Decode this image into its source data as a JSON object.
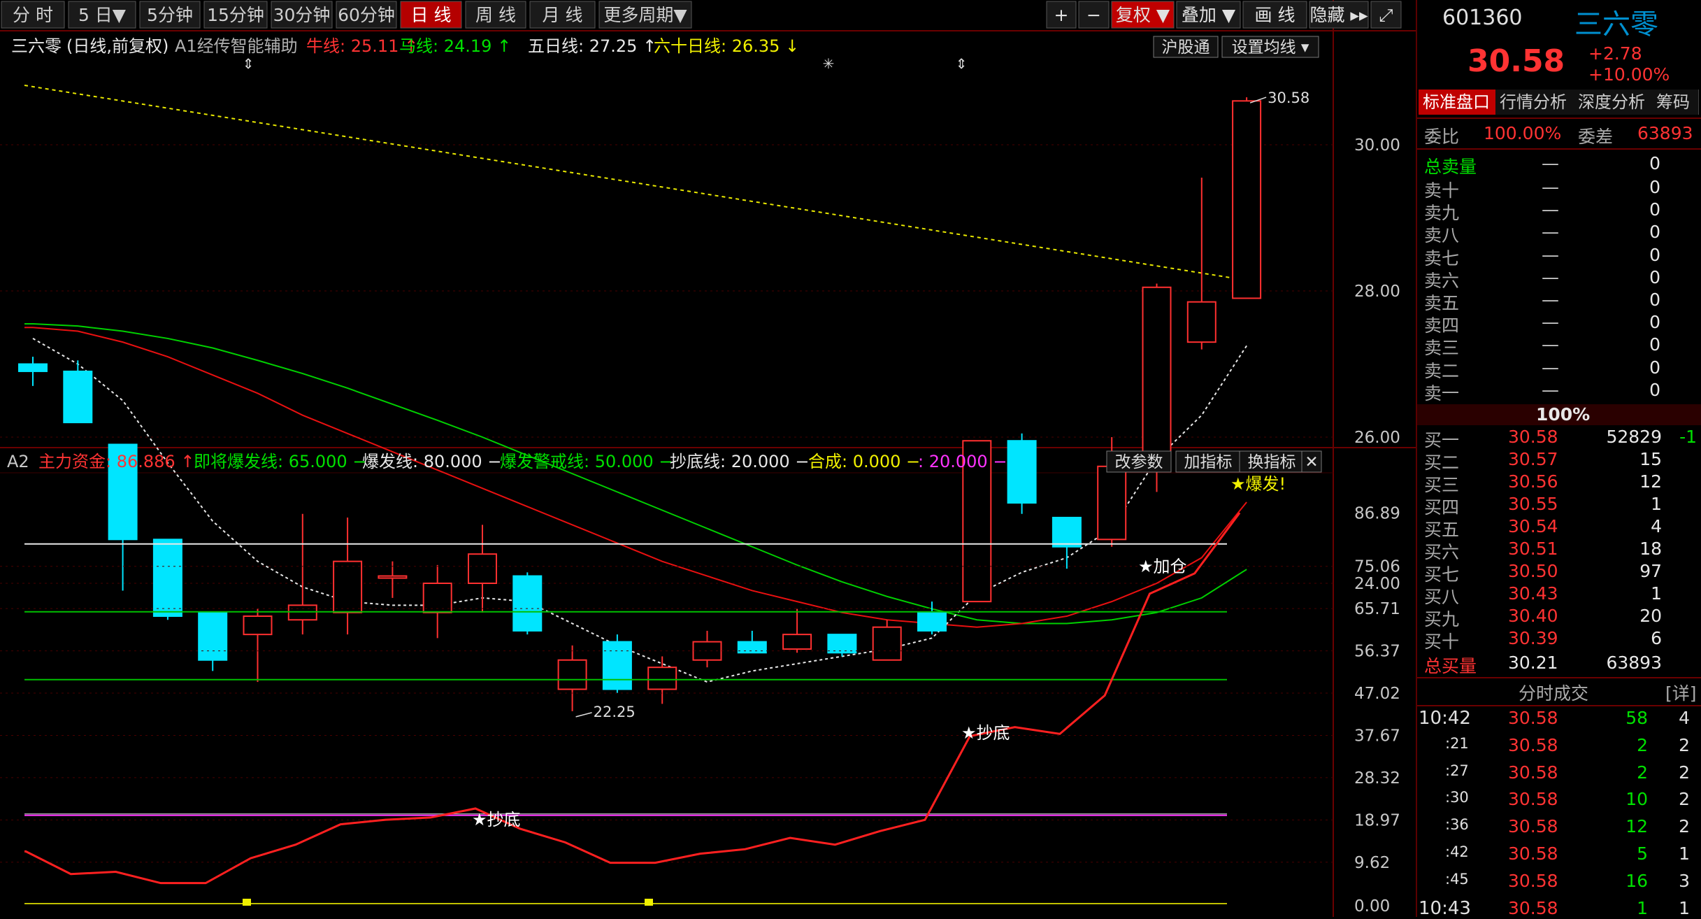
{
  "toolbar": {
    "period_buttons": [
      "分 时",
      "5 日▼",
      "5分钟",
      "15分钟",
      "30分钟",
      "60分钟",
      "日 线",
      "周 线",
      "月 线",
      "更多周期▼"
    ],
    "active_period": "日 线",
    "right_buttons": [
      "+",
      "−",
      "复权 ▼",
      "叠加 ▼",
      "画 线",
      "隐藏 ▸▸",
      "⤢"
    ]
  },
  "main_chart": {
    "title": "三六零",
    "mode": "(日线,前复权)",
    "indicator_name": "A1经传智能辅助",
    "ma_labels": [
      {
        "name": "牛线:",
        "value": "25.11",
        "arrow": "↑",
        "color": "#ff3333"
      },
      {
        "name": "马线:",
        "value": "24.19",
        "arrow": "↑",
        "color": "#00e000"
      },
      {
        "name": "五日线:",
        "value": "27.25",
        "arrow": "↑",
        "color": "#e8e8e8"
      },
      {
        "name": "六十日线:",
        "value": "26.35",
        "arrow": "↓",
        "color": "#f0f000"
      }
    ],
    "buttons": [
      "沪股通",
      "设置均线 ▾"
    ],
    "price_axis": [
      "30.00",
      "28.00",
      "26.00",
      "24.00"
    ],
    "high_label": "30.58",
    "low_label": "22.25",
    "markers": [
      "⇕",
      "✳",
      "⇕"
    ]
  },
  "lower_panel": {
    "tag": "A2",
    "labels": [
      {
        "text": "主力资金: 86.886 ↑",
        "color": "#ff3333"
      },
      {
        "text": "即将爆发线: 65.000 −",
        "color": "#00e000"
      },
      {
        "text": "爆发线: 80.000 −",
        "color": "#e8e8e8"
      },
      {
        "text": "爆发警戒线: 50.000 −",
        "color": "#00e000"
      },
      {
        "text": "抄底线: 20.000 −",
        "color": "#e8e8e8"
      },
      {
        "text": "合成: 0.000 −",
        "color": "#f0f000"
      },
      {
        "text": ": 20.000 −",
        "color": "#ff33ff"
      }
    ],
    "buttons": [
      "改参数",
      "加指标",
      "换指标",
      "✕"
    ],
    "axis": [
      "86.89",
      "75.06",
      "65.71",
      "56.37",
      "47.02",
      "37.67",
      "28.32",
      "18.97",
      "9.62",
      "0.00"
    ],
    "annotations": [
      "★爆发!",
      "★加仓",
      "★抄底",
      "★抄底"
    ]
  },
  "chart_data": {
    "type": "candlestick",
    "candles": [
      {
        "o": 27.0,
        "h": 27.1,
        "l": 26.7,
        "c": 26.9
      },
      {
        "o": 26.9,
        "h": 27.05,
        "l": 26.2,
        "c": 26.2
      },
      {
        "o": 25.9,
        "h": 25.9,
        "l": 23.9,
        "c": 24.6
      },
      {
        "o": 24.6,
        "h": 24.6,
        "l": 23.5,
        "c": 23.55
      },
      {
        "o": 23.6,
        "h": 23.6,
        "l": 22.8,
        "c": 22.95
      },
      {
        "o": 23.3,
        "h": 23.65,
        "l": 22.65,
        "c": 23.55
      },
      {
        "o": 23.5,
        "h": 24.95,
        "l": 23.3,
        "c": 23.7
      },
      {
        "o": 23.6,
        "h": 24.9,
        "l": 23.3,
        "c": 24.3
      },
      {
        "o": 24.1,
        "h": 24.3,
        "l": 23.8,
        "c": 24.1
      },
      {
        "o": 23.6,
        "h": 24.25,
        "l": 23.25,
        "c": 24.0
      },
      {
        "o": 24.0,
        "h": 24.8,
        "l": 23.6,
        "c": 24.4
      },
      {
        "o": 24.1,
        "h": 24.15,
        "l": 23.3,
        "c": 23.35
      },
      {
        "o": 22.55,
        "h": 23.15,
        "l": 22.25,
        "c": 22.95
      },
      {
        "o": 23.2,
        "h": 23.3,
        "l": 22.5,
        "c": 22.55
      },
      {
        "o": 22.55,
        "h": 23.0,
        "l": 22.35,
        "c": 22.85
      },
      {
        "o": 22.95,
        "h": 23.35,
        "l": 22.85,
        "c": 23.2
      },
      {
        "o": 23.2,
        "h": 23.35,
        "l": 23.05,
        "c": 23.05
      },
      {
        "o": 23.1,
        "h": 23.65,
        "l": 23.05,
        "c": 23.3
      },
      {
        "o": 23.3,
        "h": 23.3,
        "l": 23.0,
        "c": 23.05
      },
      {
        "o": 22.95,
        "h": 23.5,
        "l": 22.95,
        "c": 23.4
      },
      {
        "o": 23.6,
        "h": 23.75,
        "l": 23.3,
        "c": 23.35
      },
      {
        "o": 23.75,
        "h": 25.95,
        "l": 23.75,
        "c": 25.95
      },
      {
        "o": 25.95,
        "h": 26.05,
        "l": 24.95,
        "c": 25.1
      },
      {
        "o": 24.9,
        "h": 24.9,
        "l": 24.2,
        "c": 24.5
      },
      {
        "o": 24.6,
        "h": 26.0,
        "l": 24.5,
        "c": 25.6
      },
      {
        "o": 25.55,
        "h": 28.1,
        "l": 25.25,
        "c": 28.05
      },
      {
        "o": 27.3,
        "h": 29.55,
        "l": 27.2,
        "c": 27.85
      },
      {
        "o": 27.9,
        "h": 30.65,
        "l": 27.9,
        "c": 30.6
      }
    ],
    "ma_cattle": [
      27.5,
      27.45,
      27.3,
      27.1,
      26.85,
      26.6,
      26.3,
      26.05,
      25.8,
      25.55,
      25.3,
      25.05,
      24.8,
      24.55,
      24.3,
      24.1,
      23.9,
      23.75,
      23.6,
      23.5,
      23.45,
      23.4,
      23.45,
      23.55,
      23.75,
      24.0,
      24.35,
      25.11
    ],
    "ma_horse": [
      27.55,
      27.52,
      27.45,
      27.35,
      27.22,
      27.05,
      26.87,
      26.67,
      26.45,
      26.23,
      26.0,
      25.75,
      25.5,
      25.25,
      25.0,
      24.75,
      24.5,
      24.25,
      24.02,
      23.82,
      23.65,
      23.5,
      23.45,
      23.45,
      23.5,
      23.6,
      23.8,
      24.19
    ],
    "ma_5": [
      27.35,
      27.0,
      26.5,
      25.65,
      24.85,
      24.3,
      23.95,
      23.75,
      23.7,
      23.7,
      23.8,
      23.75,
      23.45,
      23.15,
      22.9,
      22.65,
      22.8,
      22.9,
      23.0,
      23.1,
      23.25,
      23.85,
      24.15,
      24.35,
      24.75,
      25.7,
      26.3,
      27.25
    ]
  },
  "lower_data": [
    12.0,
    7.0,
    7.5,
    5.0,
    5.0,
    10.5,
    13.5,
    18.0,
    19.0,
    19.5,
    21.5,
    17.0,
    14.0,
    9.5,
    9.5,
    11.5,
    12.5,
    15.0,
    13.5,
    16.5,
    19.0,
    37.5,
    39.5,
    38.0,
    46.5,
    69.0,
    73.5,
    86.886
  ],
  "quote": {
    "code": "601360",
    "name": "三六零",
    "price": "30.58",
    "change": "+2.78",
    "change_pct": "+10.00%",
    "tabs": [
      "标准盘口",
      "行情分析",
      "深度分析",
      "筹码"
    ],
    "weibi_label": "委比",
    "weibi_value": "100.00%",
    "weicha_label": "委差",
    "weicha_value": "63893",
    "total_sell_label": "总卖量",
    "total_sell_dash": "—",
    "total_sell_value": "0",
    "sell_rows": [
      {
        "label": "卖十",
        "price": "—",
        "vol": "0"
      },
      {
        "label": "卖九",
        "price": "—",
        "vol": "0"
      },
      {
        "label": "卖八",
        "price": "—",
        "vol": "0"
      },
      {
        "label": "卖七",
        "price": "—",
        "vol": "0"
      },
      {
        "label": "卖六",
        "price": "—",
        "vol": "0"
      },
      {
        "label": "卖五",
        "price": "—",
        "vol": "0"
      },
      {
        "label": "卖四",
        "price": "—",
        "vol": "0"
      },
      {
        "label": "卖三",
        "price": "—",
        "vol": "0"
      },
      {
        "label": "卖二",
        "price": "—",
        "vol": "0"
      },
      {
        "label": "卖一",
        "price": "—",
        "vol": "0"
      }
    ],
    "mid_percent": "100%",
    "buy_rows": [
      {
        "label": "买一",
        "price": "30.58",
        "vol": "52829",
        "chg": "-1"
      },
      {
        "label": "买二",
        "price": "30.57",
        "vol": "15",
        "chg": ""
      },
      {
        "label": "买三",
        "price": "30.56",
        "vol": "12",
        "chg": ""
      },
      {
        "label": "买四",
        "price": "30.55",
        "vol": "1",
        "chg": ""
      },
      {
        "label": "买五",
        "price": "30.54",
        "vol": "4",
        "chg": ""
      },
      {
        "label": "买六",
        "price": "30.51",
        "vol": "18",
        "chg": ""
      },
      {
        "label": "买七",
        "price": "30.50",
        "vol": "97",
        "chg": ""
      },
      {
        "label": "买八",
        "price": "30.43",
        "vol": "1",
        "chg": ""
      },
      {
        "label": "买九",
        "price": "30.40",
        "vol": "20",
        "chg": ""
      },
      {
        "label": "买十",
        "price": "30.39",
        "vol": "6",
        "chg": ""
      }
    ],
    "total_buy_label": "总买量",
    "total_buy_price": "30.21",
    "total_buy_value": "63893",
    "trades_title": "分时成交",
    "trades_detail": "[详]",
    "trades": [
      {
        "time": "10:42",
        "price": "30.58",
        "vol": "58",
        "n": "4"
      },
      {
        "time": ":21",
        "price": "30.58",
        "vol": "2",
        "n": "2"
      },
      {
        "time": ":27",
        "price": "30.58",
        "vol": "2",
        "n": "2"
      },
      {
        "time": ":30",
        "price": "30.58",
        "vol": "10",
        "n": "2"
      },
      {
        "time": ":36",
        "price": "30.58",
        "vol": "12",
        "n": "2"
      },
      {
        "time": ":42",
        "price": "30.58",
        "vol": "5",
        "n": "1"
      },
      {
        "time": ":45",
        "price": "30.58",
        "vol": "16",
        "n": "3"
      },
      {
        "time": "10:43",
        "price": "30.58",
        "vol": "1",
        "n": "1"
      }
    ]
  }
}
